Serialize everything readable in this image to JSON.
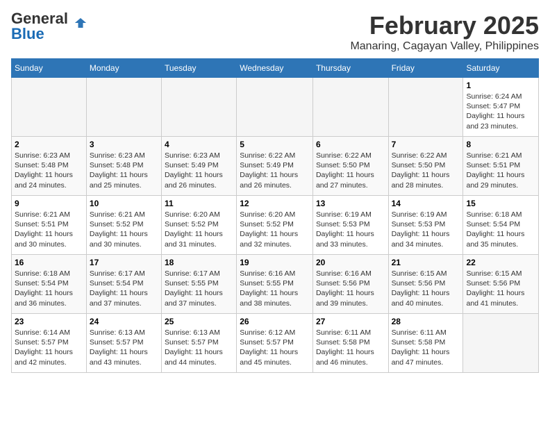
{
  "header": {
    "logo_general": "General",
    "logo_blue": "Blue",
    "month_year": "February 2025",
    "location": "Manaring, Cagayan Valley, Philippines"
  },
  "days_of_week": [
    "Sunday",
    "Monday",
    "Tuesday",
    "Wednesday",
    "Thursday",
    "Friday",
    "Saturday"
  ],
  "weeks": [
    [
      {
        "day": "",
        "detail": ""
      },
      {
        "day": "",
        "detail": ""
      },
      {
        "day": "",
        "detail": ""
      },
      {
        "day": "",
        "detail": ""
      },
      {
        "day": "",
        "detail": ""
      },
      {
        "day": "",
        "detail": ""
      },
      {
        "day": "1",
        "detail": "Sunrise: 6:24 AM\nSunset: 5:47 PM\nDaylight: 11 hours and 23 minutes."
      }
    ],
    [
      {
        "day": "2",
        "detail": "Sunrise: 6:23 AM\nSunset: 5:48 PM\nDaylight: 11 hours and 24 minutes."
      },
      {
        "day": "3",
        "detail": "Sunrise: 6:23 AM\nSunset: 5:48 PM\nDaylight: 11 hours and 25 minutes."
      },
      {
        "day": "4",
        "detail": "Sunrise: 6:23 AM\nSunset: 5:49 PM\nDaylight: 11 hours and 26 minutes."
      },
      {
        "day": "5",
        "detail": "Sunrise: 6:22 AM\nSunset: 5:49 PM\nDaylight: 11 hours and 26 minutes."
      },
      {
        "day": "6",
        "detail": "Sunrise: 6:22 AM\nSunset: 5:50 PM\nDaylight: 11 hours and 27 minutes."
      },
      {
        "day": "7",
        "detail": "Sunrise: 6:22 AM\nSunset: 5:50 PM\nDaylight: 11 hours and 28 minutes."
      },
      {
        "day": "8",
        "detail": "Sunrise: 6:21 AM\nSunset: 5:51 PM\nDaylight: 11 hours and 29 minutes."
      }
    ],
    [
      {
        "day": "9",
        "detail": "Sunrise: 6:21 AM\nSunset: 5:51 PM\nDaylight: 11 hours and 30 minutes."
      },
      {
        "day": "10",
        "detail": "Sunrise: 6:21 AM\nSunset: 5:52 PM\nDaylight: 11 hours and 30 minutes."
      },
      {
        "day": "11",
        "detail": "Sunrise: 6:20 AM\nSunset: 5:52 PM\nDaylight: 11 hours and 31 minutes."
      },
      {
        "day": "12",
        "detail": "Sunrise: 6:20 AM\nSunset: 5:52 PM\nDaylight: 11 hours and 32 minutes."
      },
      {
        "day": "13",
        "detail": "Sunrise: 6:19 AM\nSunset: 5:53 PM\nDaylight: 11 hours and 33 minutes."
      },
      {
        "day": "14",
        "detail": "Sunrise: 6:19 AM\nSunset: 5:53 PM\nDaylight: 11 hours and 34 minutes."
      },
      {
        "day": "15",
        "detail": "Sunrise: 6:18 AM\nSunset: 5:54 PM\nDaylight: 11 hours and 35 minutes."
      }
    ],
    [
      {
        "day": "16",
        "detail": "Sunrise: 6:18 AM\nSunset: 5:54 PM\nDaylight: 11 hours and 36 minutes."
      },
      {
        "day": "17",
        "detail": "Sunrise: 6:17 AM\nSunset: 5:54 PM\nDaylight: 11 hours and 37 minutes."
      },
      {
        "day": "18",
        "detail": "Sunrise: 6:17 AM\nSunset: 5:55 PM\nDaylight: 11 hours and 37 minutes."
      },
      {
        "day": "19",
        "detail": "Sunrise: 6:16 AM\nSunset: 5:55 PM\nDaylight: 11 hours and 38 minutes."
      },
      {
        "day": "20",
        "detail": "Sunrise: 6:16 AM\nSunset: 5:56 PM\nDaylight: 11 hours and 39 minutes."
      },
      {
        "day": "21",
        "detail": "Sunrise: 6:15 AM\nSunset: 5:56 PM\nDaylight: 11 hours and 40 minutes."
      },
      {
        "day": "22",
        "detail": "Sunrise: 6:15 AM\nSunset: 5:56 PM\nDaylight: 11 hours and 41 minutes."
      }
    ],
    [
      {
        "day": "23",
        "detail": "Sunrise: 6:14 AM\nSunset: 5:57 PM\nDaylight: 11 hours and 42 minutes."
      },
      {
        "day": "24",
        "detail": "Sunrise: 6:13 AM\nSunset: 5:57 PM\nDaylight: 11 hours and 43 minutes."
      },
      {
        "day": "25",
        "detail": "Sunrise: 6:13 AM\nSunset: 5:57 PM\nDaylight: 11 hours and 44 minutes."
      },
      {
        "day": "26",
        "detail": "Sunrise: 6:12 AM\nSunset: 5:57 PM\nDaylight: 11 hours and 45 minutes."
      },
      {
        "day": "27",
        "detail": "Sunrise: 6:11 AM\nSunset: 5:58 PM\nDaylight: 11 hours and 46 minutes."
      },
      {
        "day": "28",
        "detail": "Sunrise: 6:11 AM\nSunset: 5:58 PM\nDaylight: 11 hours and 47 minutes."
      },
      {
        "day": "",
        "detail": ""
      }
    ]
  ]
}
